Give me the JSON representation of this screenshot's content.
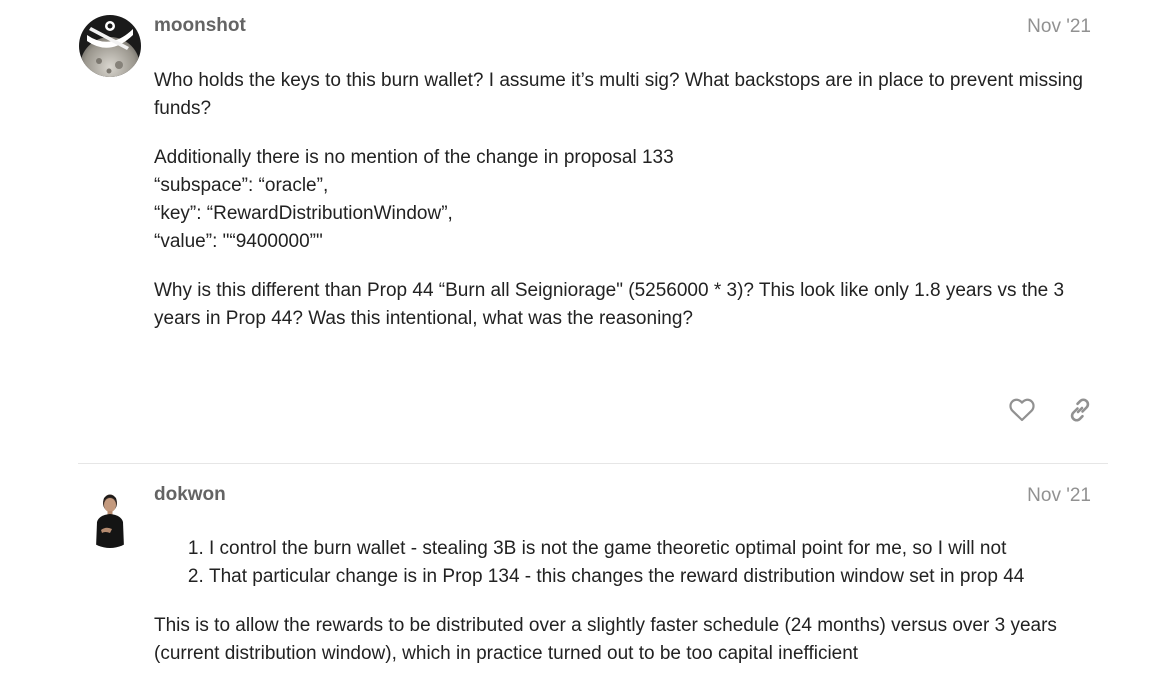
{
  "posts": [
    {
      "username": "moonshot",
      "date": "Nov '21",
      "paragraphs": [
        "Who holds the keys to this burn wallet? I assume it’s multi sig? What backstops are in place to prevent missing funds?",
        "Additionally there is no mention of the change in proposal 133",
        "“subspace”: “oracle”,",
        "“key”: “RewardDistributionWindow”,",
        "“value”: \"“9400000”\"",
        "Why is this different than Prop 44 “Burn all Seigniorage\" (5256000 * 3)? This look like only 1.8 years vs the 3 years in Prop 44? Was this intentional, what was the reasoning?"
      ],
      "actions": {
        "like_icon": "heart-icon",
        "share_icon": "link-icon"
      }
    },
    {
      "username": "dokwon",
      "date": "Nov '21",
      "list_items": [
        "I control the burn wallet - stealing 3B is not the game theoretic optimal point for me, so I will not",
        "That particular change is in Prop 134 - this changes the reward distribution window set in prop 44"
      ],
      "paragraphs": [
        "This is to allow the rewards to be distributed over a slightly faster schedule (24 months) versus over 3 years (current distribution window), which in practice turned out to be too capital inefficient"
      ]
    }
  ],
  "colors": {
    "username": "#646464",
    "date": "#919191",
    "text": "#222222",
    "icon": "#919191",
    "divider": "#e6e6e6"
  }
}
